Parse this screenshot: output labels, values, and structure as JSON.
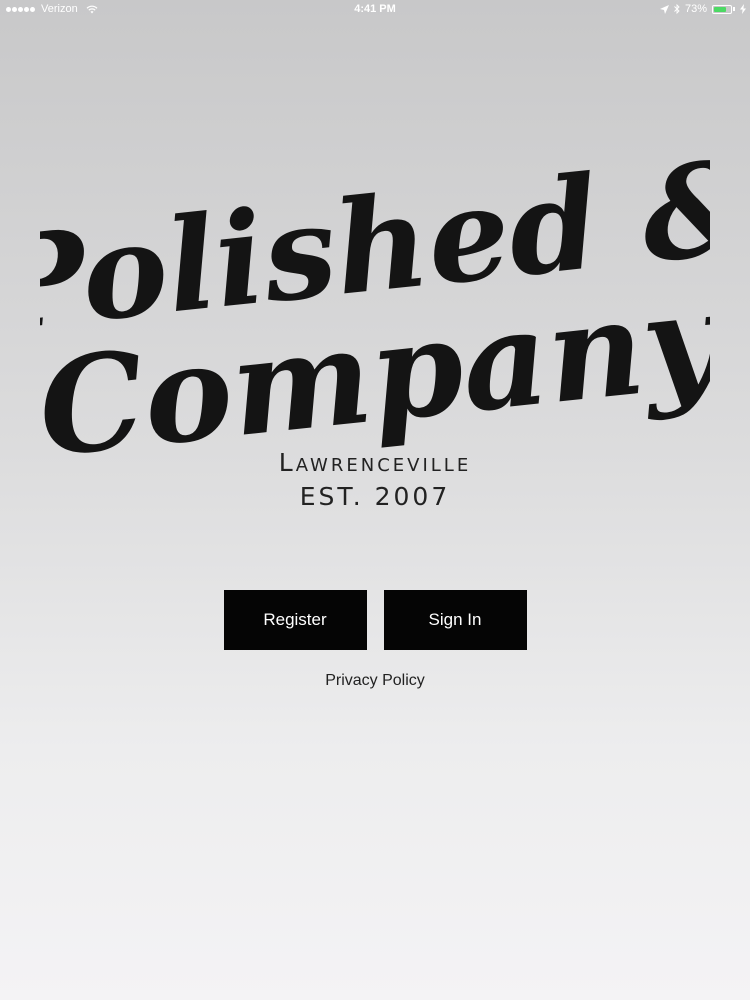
{
  "status_bar": {
    "carrier": "Verizon",
    "time": "4:41 PM",
    "battery_percent": "73%",
    "battery_level": 0.73,
    "icons": [
      "signal-dots-icon",
      "wifi-icon",
      "location-arrow-icon",
      "bluetooth-icon",
      "battery-icon",
      "charging-bolt-icon"
    ]
  },
  "logo": {
    "line1": "Polished &",
    "line2": "Company",
    "location": "Lawrenceville",
    "established": "EST. 2007"
  },
  "actions": {
    "register_label": "Register",
    "sign_in_label": "Sign In",
    "privacy_label": "Privacy Policy"
  },
  "colors": {
    "button_bg": "#050505",
    "button_text": "#ffffff",
    "battery_fill": "#4cd964"
  }
}
